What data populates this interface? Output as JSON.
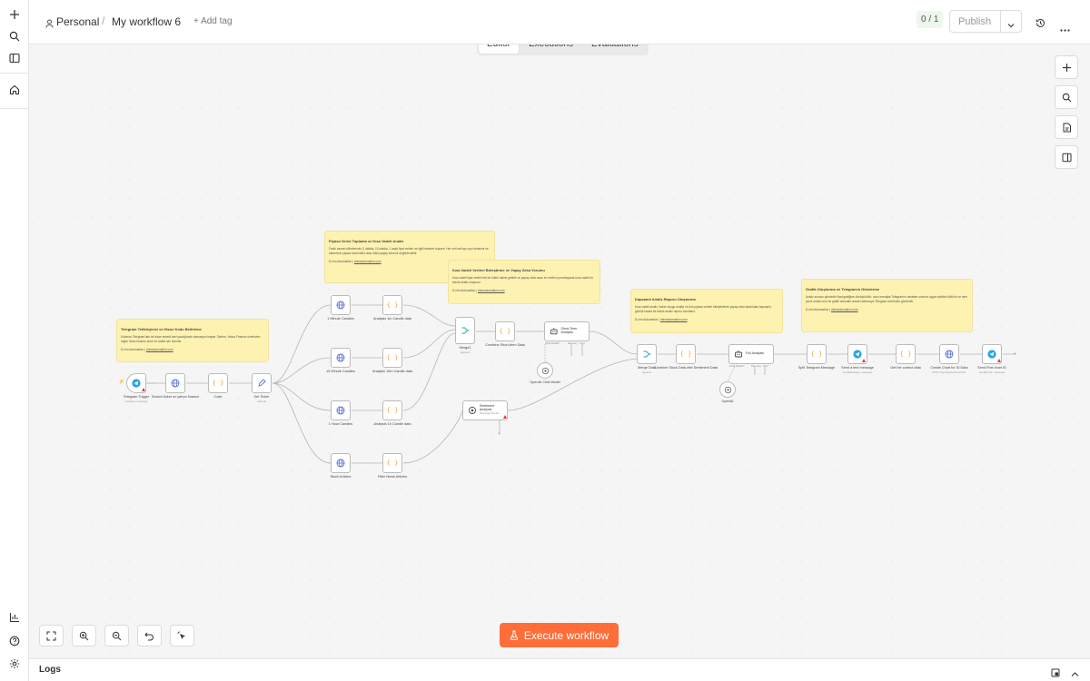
{
  "header": {
    "project": "Personal",
    "separator": "/",
    "workflow_name": "My workflow 6",
    "add_tag": "+ Add tag",
    "counter": "0 / 1",
    "publish": "Publish"
  },
  "tabs": [
    "Editor",
    "Executions",
    "Evaluations"
  ],
  "execute_label": "Execute workflow",
  "logs_label": "Logs",
  "sticky_notes": [
    {
      "title": "Telegram Tetikleyicisi ve Hisse Kodu Belirleme",
      "body": "Kullanıcı Telegram'dan bir hisse senedi ismi yazdığında otomasyon başlar. Sistem, Yahoo Finance üzerinden doğru hisse kodunu bulur ve analiz için hazırlar.",
      "credit": "D-nim Automation |",
      "link": "dnimautomation.com"
    },
    {
      "title": "Piyasa Verisi Toplama ve Kısa Vadeli Analiz",
      "body": "Farklı zaman dilimlerinde (1 dakika, 15 dakika, 1 saat) fiyat verileri ve ilgili haberler toplanır. Her veri seti ayrı ayrı incelenir ve haberlerin piyasa üzerindeki olası etkisi yapay zeka ile değerlendirilir.",
      "credit": "D-nim Automation |",
      "link": "dnimautomation.com"
    },
    {
      "title": "Kısa Vadeli Verileri Birleştirme ve Yapay Zeka Yorumu",
      "body": "Kısa vadeli fiyat verileri tek bir bütün haline getirilir ve yapay zeka aracı bu verileri yorumlayarak kısa vadeli bir teknik analiz oluşturur.",
      "credit": "D-nim Automation |",
      "link": "dnimautomation.com"
    },
    {
      "title": "Kapsamlı Analiz Raporu Oluşturma",
      "body": "Kısa vadeli analiz, haber duygu analizi ve tüm piyasa verileri birleştirilerek yapay zeka tarafından kapsamlı, günlük bazda bir teknik analiz raporu hazırlanır.",
      "credit": "D-nim Automation |",
      "link": "dnimautomation.com"
    },
    {
      "title": "Grafik Oluşturma ve Telegram'a Gönderme",
      "body": "Analiz sonucu gönderilir fiyat grafiğine dönüştürülür, uzun mesajlar Telegram'ın karakter sınırına uygun şekilde bölünür ve hem yazılı analiz hem de grafik otomatik olarak kullanıcıya Telegram üzerinden gönderilir.",
      "credit": "D-nim Automation |",
      "link": "dnimautomation.com"
    }
  ],
  "nodes": [
    {
      "label": "Telegram Trigger",
      "sub": "Updates: message",
      "icon": "telegram-icon",
      "color": "#2aa3dd"
    },
    {
      "label": "Search ticker on yahoo finance",
      "sub": "",
      "icon": "globe-icon",
      "color": "#5a6fd6"
    },
    {
      "label": "Code",
      "sub": "",
      "icon": "code-icon",
      "color": "#ff9b26"
    },
    {
      "label": "Set Ticker",
      "sub": "manual",
      "icon": "edit-icon",
      "color": "#5a6fd6"
    },
    {
      "label": "1 Minute Candles",
      "sub": "",
      "icon": "globe-icon",
      "color": "#5a6fd6"
    },
    {
      "label": "Analysis 1m Candle data",
      "sub": "",
      "icon": "code-icon",
      "color": "#ff9b26"
    },
    {
      "label": "15 Minute Candles",
      "sub": "",
      "icon": "globe-icon",
      "color": "#5a6fd6"
    },
    {
      "label": "Analysis 15m Candle data",
      "sub": "",
      "icon": "code-icon",
      "color": "#ff9b26"
    },
    {
      "label": "1 Hour Candles",
      "sub": "",
      "icon": "globe-icon",
      "color": "#5a6fd6"
    },
    {
      "label": "Analysis 1h Candle data",
      "sub": "",
      "icon": "code-icon",
      "color": "#ff9b26"
    },
    {
      "label": "Stock Articles",
      "sub": "",
      "icon": "globe-icon",
      "color": "#5a6fd6"
    },
    {
      "label": "Filter News Articles",
      "sub": "",
      "icon": "code-icon",
      "color": "#ff9b26"
    },
    {
      "label": "Merge1",
      "sub": "append",
      "icon": "merge-icon",
      "color": "#1aa8a0"
    },
    {
      "label": "Combine Short-term Data",
      "sub": "",
      "icon": "code-icon",
      "color": "#ff9b26"
    },
    {
      "label": "Short-Term Analysis",
      "sub": "",
      "icon": "robot-icon",
      "color": "#444444"
    },
    {
      "label": "OpenAI Chat Model",
      "sub": "",
      "icon": "openai-icon",
      "color": "#666666"
    },
    {
      "label": "Sentiment Analysis",
      "sub": "Message Model",
      "icon": "openai-icon",
      "color": "#444444"
    },
    {
      "label": "Merge Data",
      "sub": "append",
      "icon": "merge-icon",
      "color": "#1aa8a0"
    },
    {
      "label": "Combine Stock Data with Sentiment Data",
      "sub": "",
      "icon": "code-icon",
      "color": "#ff9b26"
    },
    {
      "label": "Full Analysis",
      "sub": "",
      "icon": "robot-icon",
      "color": "#444444"
    },
    {
      "label": "OpenAI",
      "sub": "",
      "icon": "openai-icon",
      "color": "#666666"
    },
    {
      "label": "Split Telegram Message",
      "sub": "",
      "icon": "code-icon",
      "color": "#ff9b26"
    },
    {
      "label": "Send a text message",
      "sub": "sendMessage: message",
      "icon": "telegram-icon",
      "color": "#2aa3dd"
    },
    {
      "label": "Get the correct data",
      "sub": "",
      "icon": "code-icon",
      "color": "#ff9b26"
    },
    {
      "label": "Create Chart for ID Data",
      "sub": "POST: https://quickchart.io/chart",
      "icon": "globe-icon",
      "color": "#5a6fd6"
    },
    {
      "label": "Send First chart ID",
      "sub": "sendPhoto: message",
      "icon": "telegram-icon",
      "color": "#2aa3dd"
    }
  ],
  "agent_ports": {
    "chat_model": "Chat Model*",
    "memory": "Memory",
    "tool": "Tool",
    "model": "Model"
  },
  "colors": {
    "accent": "#ff6d39",
    "sticky": "#fdf2b0",
    "error": "#e0363b"
  }
}
